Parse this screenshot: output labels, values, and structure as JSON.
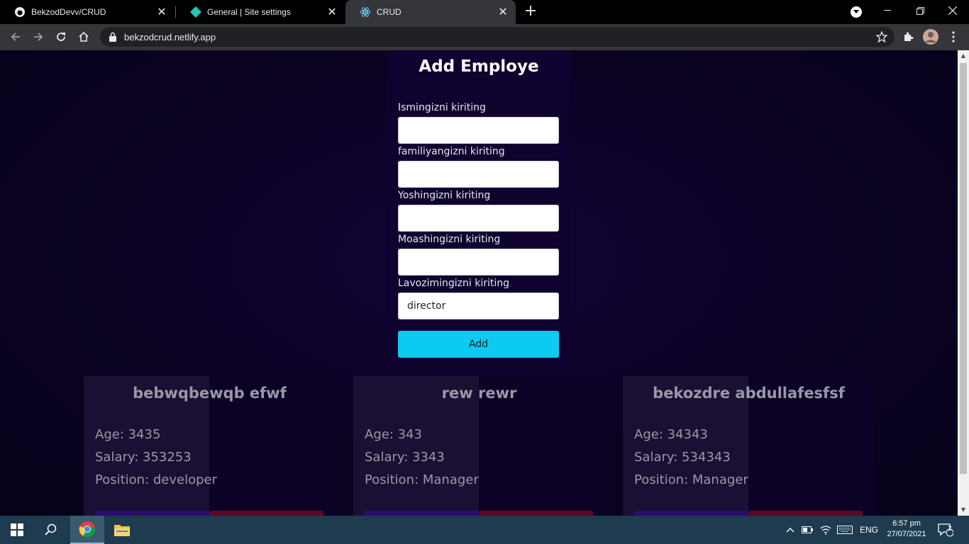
{
  "browser": {
    "tabs": [
      {
        "title": "BekzodDevv/CRUD",
        "favicon": "github-icon"
      },
      {
        "title": "General | Site settings",
        "favicon": "netlify-icon"
      },
      {
        "title": "CRUD",
        "favicon": "react-icon",
        "active": true
      }
    ],
    "url": "bekzodcrud.netlify.app"
  },
  "form": {
    "title": "Add Employe",
    "fields": [
      {
        "label": "Ismingizni kiriting",
        "value": ""
      },
      {
        "label": "familiyangizni kiriting",
        "value": ""
      },
      {
        "label": "Yoshingizni kiriting",
        "value": ""
      },
      {
        "label": "Moashingizni kiriting",
        "value": ""
      },
      {
        "label": "Lavozimingizni kiriting",
        "value": "director"
      }
    ],
    "add_label": "Add"
  },
  "employees": [
    {
      "name": "bebwqbewqb efwf",
      "age": "Age: 3435",
      "salary": "Salary: 353253",
      "position": "Position: developer"
    },
    {
      "name": "rew rewr",
      "age": "Age: 343",
      "salary": "Salary: 3343",
      "position": "Position: Manager"
    },
    {
      "name": "bekozdre abdullafesfsf",
      "age": "Age: 34343",
      "salary": "Salary: 534343",
      "position": "Position: Manager"
    }
  ],
  "taskbar": {
    "language": "ENG",
    "time": "6:57 pm",
    "date": "27/07/2021",
    "notifications": "2"
  },
  "colors": {
    "accent_button": "#0dcaf0",
    "page_background": "#0a0118",
    "form_background": "#10022f"
  }
}
